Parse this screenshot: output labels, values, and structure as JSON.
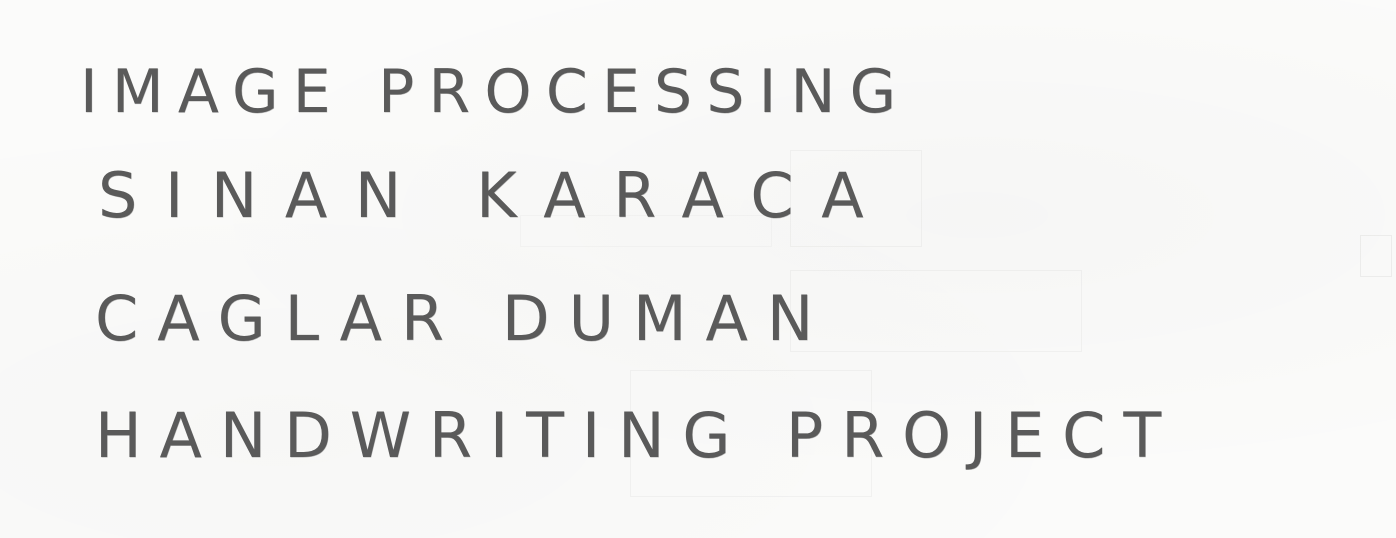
{
  "document": {
    "lines": [
      "IMAGE PROCESSING",
      "SINAN KARACA",
      "CAGLAR DUMAN",
      "HANDWRITING PROJECT"
    ]
  },
  "colors": {
    "paper": "#fbfbfa",
    "pencil": "#5a5a5a"
  }
}
